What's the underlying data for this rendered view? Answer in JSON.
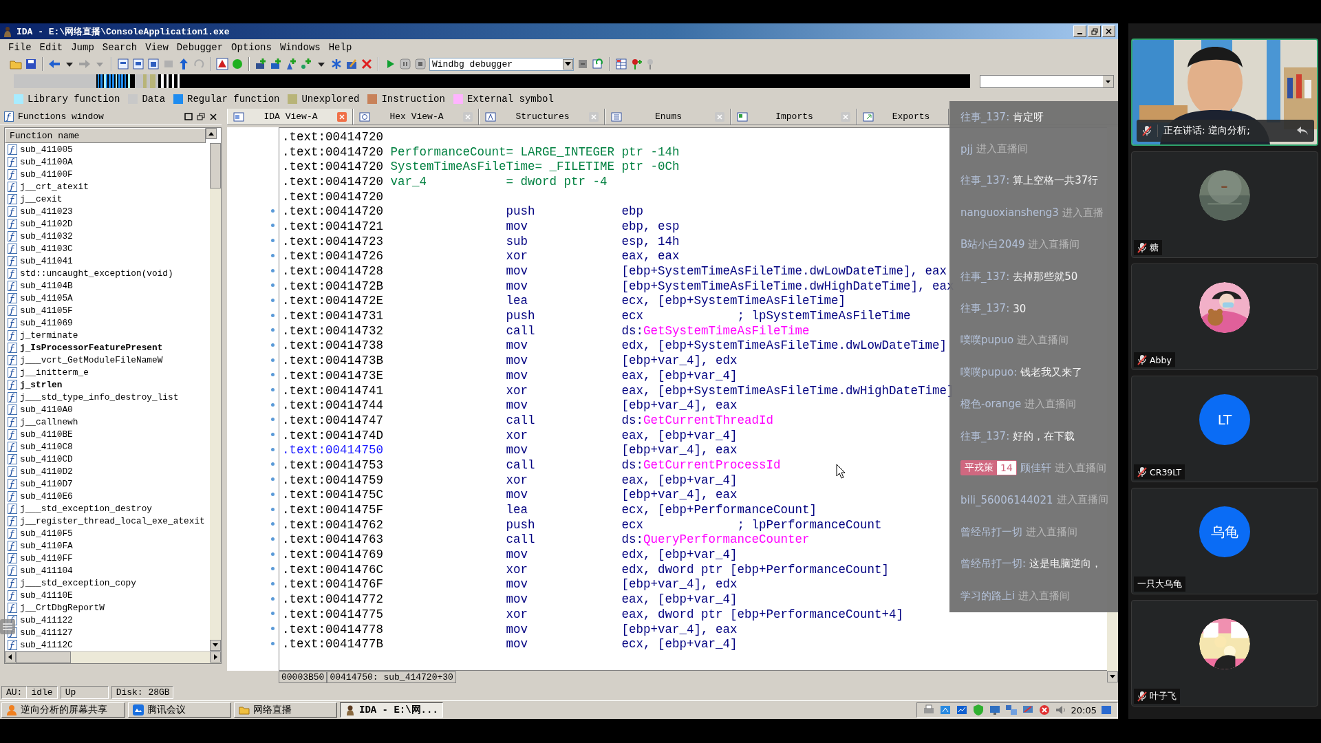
{
  "window": {
    "title": "IDA - E:\\网络直播\\ConsoleApplication1.exe"
  },
  "menu": [
    "File",
    "Edit",
    "Jump",
    "Search",
    "View",
    "Debugger",
    "Options",
    "Windows",
    "Help"
  ],
  "toolbar": {
    "debugger": "Windbg debugger"
  },
  "legend": [
    {
      "label": "Library function",
      "color": "#a8ecff"
    },
    {
      "label": "Data",
      "color": "#c8c8c8"
    },
    {
      "label": "Regular function",
      "color": "#1e8cf0"
    },
    {
      "label": "Unexplored",
      "color": "#b8b478"
    },
    {
      "label": "Instruction",
      "color": "#c8825a"
    },
    {
      "label": "External symbol",
      "color": "#ffb4ff"
    }
  ],
  "functions_window": {
    "title": "Functions window",
    "column": "Function name",
    "items": [
      {
        "name": "sub_411005",
        "bold": false
      },
      {
        "name": "sub_41100A",
        "bold": false
      },
      {
        "name": "sub_41100F",
        "bold": false
      },
      {
        "name": "j__crt_atexit",
        "bold": false
      },
      {
        "name": "j__cexit",
        "bold": false
      },
      {
        "name": "sub_411023",
        "bold": false
      },
      {
        "name": "sub_41102D",
        "bold": false
      },
      {
        "name": "sub_411032",
        "bold": false
      },
      {
        "name": "sub_41103C",
        "bold": false
      },
      {
        "name": "sub_411041",
        "bold": false
      },
      {
        "name": "std::uncaught_exception(void)",
        "bold": false
      },
      {
        "name": "sub_41104B",
        "bold": false
      },
      {
        "name": "sub_41105A",
        "bold": false
      },
      {
        "name": "sub_41105F",
        "bold": false
      },
      {
        "name": "sub_411069",
        "bold": false
      },
      {
        "name": "j_terminate",
        "bold": false
      },
      {
        "name": "j_IsProcessorFeaturePresent",
        "bold": true
      },
      {
        "name": "j___vcrt_GetModuleFileNameW",
        "bold": false
      },
      {
        "name": "j__initterm_e",
        "bold": false
      },
      {
        "name": "j_strlen",
        "bold": true
      },
      {
        "name": "j___std_type_info_destroy_list",
        "bold": false
      },
      {
        "name": "sub_4110A0",
        "bold": false
      },
      {
        "name": "j__callnewh",
        "bold": false
      },
      {
        "name": "sub_4110BE",
        "bold": false
      },
      {
        "name": "sub_4110C8",
        "bold": false
      },
      {
        "name": "sub_4110CD",
        "bold": false
      },
      {
        "name": "sub_4110D2",
        "bold": false
      },
      {
        "name": "sub_4110D7",
        "bold": false
      },
      {
        "name": "sub_4110E6",
        "bold": false
      },
      {
        "name": "j___std_exception_destroy",
        "bold": false
      },
      {
        "name": "j__register_thread_local_exe_atexit",
        "bold": false
      },
      {
        "name": "sub_4110F5",
        "bold": false
      },
      {
        "name": "sub_4110FA",
        "bold": false
      },
      {
        "name": "sub_4110FF",
        "bold": false
      },
      {
        "name": "sub_411104",
        "bold": false
      },
      {
        "name": "j___std_exception_copy",
        "bold": false
      },
      {
        "name": "sub_41110E",
        "bold": false
      },
      {
        "name": "j__CrtDbgReportW",
        "bold": false
      },
      {
        "name": "sub_411122",
        "bold": false
      },
      {
        "name": "sub_411127",
        "bold": false
      },
      {
        "name": "sub_41112C",
        "bold": false
      }
    ]
  },
  "tabs": [
    {
      "label": "IDA View-A",
      "selected": true
    },
    {
      "label": "Hex View-A",
      "selected": false
    },
    {
      "label": "Structures",
      "selected": false
    },
    {
      "label": "Enums",
      "selected": false
    },
    {
      "label": "Imports",
      "selected": false
    },
    {
      "label": "Exports",
      "selected": false
    }
  ],
  "listing": {
    "location": "00003B50",
    "position": "00414750: sub_414720+30",
    "lines": [
      {
        "kind": "blank",
        "address": ".text:00414720",
        "current": false
      },
      {
        "kind": "stackvar",
        "address": ".text:00414720",
        "name": "PerformanceCount",
        "definition": "= LARGE_INTEGER ptr -14h",
        "current": false
      },
      {
        "kind": "stackvar",
        "address": ".text:00414720",
        "name": "SystemTimeAsFileTime",
        "definition": "= _FILETIME ptr -0Ch",
        "current": false
      },
      {
        "kind": "stackvar",
        "address": ".text:00414720",
        "name": "var_4",
        "definition": "= dword ptr -4",
        "current": false
      },
      {
        "kind": "blank",
        "address": ".text:00414720",
        "current": false
      },
      {
        "kind": "instruction",
        "address": ".text:00414720",
        "mnemonic": "push",
        "operands": "ebp",
        "current": false
      },
      {
        "kind": "instruction",
        "address": ".text:00414721",
        "mnemonic": "mov",
        "operands": "ebp, esp",
        "current": false
      },
      {
        "kind": "instruction",
        "address": ".text:00414723",
        "mnemonic": "sub",
        "operands": "esp, 14h",
        "current": false
      },
      {
        "kind": "instruction",
        "address": ".text:00414726",
        "mnemonic": "xor",
        "operands": "eax, eax",
        "current": false
      },
      {
        "kind": "instruction",
        "address": ".text:00414728",
        "mnemonic": "mov",
        "operands": "[ebp+SystemTimeAsFileTime.dwLowDateTime], eax",
        "current": false
      },
      {
        "kind": "instruction",
        "address": ".text:0041472B",
        "mnemonic": "mov",
        "operands": "[ebp+SystemTimeAsFileTime.dwHighDateTime], eax",
        "current": false
      },
      {
        "kind": "instruction",
        "address": ".text:0041472E",
        "mnemonic": "lea",
        "operands": "ecx, [ebp+SystemTimeAsFileTime]",
        "current": false
      },
      {
        "kind": "instruction",
        "address": ".text:00414731",
        "mnemonic": "push",
        "operands": "ecx",
        "comment": "; lpSystemTimeAsFileTime",
        "current": false
      },
      {
        "kind": "instruction",
        "address": ".text:00414732",
        "mnemonic": "call",
        "operands": "ds:",
        "symbol": "GetSystemTimeAsFileTime",
        "current": false
      },
      {
        "kind": "instruction",
        "address": ".text:00414738",
        "mnemonic": "mov",
        "operands": "edx, [ebp+SystemTimeAsFileTime.dwLowDateTime]",
        "current": false
      },
      {
        "kind": "instruction",
        "address": ".text:0041473B",
        "mnemonic": "mov",
        "operands": "[ebp+var_4], edx",
        "current": false
      },
      {
        "kind": "instruction",
        "address": ".text:0041473E",
        "mnemonic": "mov",
        "operands": "eax, [ebp+var_4]",
        "current": false
      },
      {
        "kind": "instruction",
        "address": ".text:00414741",
        "mnemonic": "xor",
        "operands": "eax, [ebp+SystemTimeAsFileTime.dwHighDateTime]",
        "current": false
      },
      {
        "kind": "instruction",
        "address": ".text:00414744",
        "mnemonic": "mov",
        "operands": "[ebp+var_4], eax",
        "current": false
      },
      {
        "kind": "instruction",
        "address": ".text:00414747",
        "mnemonic": "call",
        "operands": "ds:",
        "symbol": "GetCurrentThreadId",
        "current": false
      },
      {
        "kind": "instruction",
        "address": ".text:0041474D",
        "mnemonic": "xor",
        "operands": "eax, [ebp+var_4]",
        "current": false
      },
      {
        "kind": "instruction",
        "address": ".text:00414750",
        "mnemonic": "mov",
        "operands": "[ebp+var_4], eax",
        "current": true
      },
      {
        "kind": "instruction",
        "address": ".text:00414753",
        "mnemonic": "call",
        "operands": "ds:",
        "symbol": "GetCurrentProcessId",
        "current": false
      },
      {
        "kind": "instruction",
        "address": ".text:00414759",
        "mnemonic": "xor",
        "operands": "eax, [ebp+var_4]",
        "current": false
      },
      {
        "kind": "instruction",
        "address": ".text:0041475C",
        "mnemonic": "mov",
        "operands": "[ebp+var_4], eax",
        "current": false
      },
      {
        "kind": "instruction",
        "address": ".text:0041475F",
        "mnemonic": "lea",
        "operands": "ecx, [ebp+PerformanceCount]",
        "current": false
      },
      {
        "kind": "instruction",
        "address": ".text:00414762",
        "mnemonic": "push",
        "operands": "ecx",
        "comment": "; lpPerformanceCount",
        "current": false
      },
      {
        "kind": "instruction",
        "address": ".text:00414763",
        "mnemonic": "call",
        "operands": "ds:",
        "symbol": "QueryPerformanceCounter",
        "current": false
      },
      {
        "kind": "instruction",
        "address": ".text:00414769",
        "mnemonic": "mov",
        "operands": "edx, [ebp+var_4]",
        "current": false
      },
      {
        "kind": "instruction",
        "address": ".text:0041476C",
        "mnemonic": "xor",
        "operands": "edx, dword ptr [ebp+PerformanceCount]",
        "current": false
      },
      {
        "kind": "instruction",
        "address": ".text:0041476F",
        "mnemonic": "mov",
        "operands": "[ebp+var_4], edx",
        "current": false
      },
      {
        "kind": "instruction",
        "address": ".text:00414772",
        "mnemonic": "mov",
        "operands": "eax, [ebp+var_4]",
        "current": false
      },
      {
        "kind": "instruction",
        "address": ".text:00414775",
        "mnemonic": "xor",
        "operands": "eax, dword ptr [ebp+PerformanceCount+4]",
        "current": false
      },
      {
        "kind": "instruction",
        "address": ".text:00414778",
        "mnemonic": "mov",
        "operands": "[ebp+var_4], eax",
        "current": false
      },
      {
        "kind": "instruction",
        "address": ".text:0041477B",
        "mnemonic": "mov",
        "operands": "ecx, [ebp+var_4]",
        "current": false
      }
    ]
  },
  "chat": [
    {
      "kind": "message",
      "user": "往事_137:",
      "text": "肯定呀"
    },
    {
      "kind": "join",
      "user": "pjj",
      "text": "进入直播间"
    },
    {
      "kind": "message",
      "user": "往事_137:",
      "text": "算上空格一共37行"
    },
    {
      "kind": "join",
      "user": "nanguoxiansheng3",
      "text": "进入直播"
    },
    {
      "kind": "join",
      "user": "B站小白2049",
      "text": "进入直播间"
    },
    {
      "kind": "message",
      "user": "往事_137:",
      "text": "去掉那些就50"
    },
    {
      "kind": "message",
      "user": "往事_137:",
      "text": "30"
    },
    {
      "kind": "join",
      "user": "噗噗pupuo",
      "text": "进入直播间"
    },
    {
      "kind": "message",
      "user": "噗噗pupuo:",
      "text": "钱老我又来了"
    },
    {
      "kind": "join",
      "user": "橙色-orange",
      "text": "进入直播间"
    },
    {
      "kind": "message",
      "user": "往事_137:",
      "text": "好的，在下载"
    },
    {
      "kind": "join",
      "badge": {
        "name": "平戎策",
        "level": "14"
      },
      "user": "顾佳轩",
      "text": "进入直播间"
    },
    {
      "kind": "join",
      "user": "bili_56006144021",
      "text": "进入直播间"
    },
    {
      "kind": "join",
      "user": "曾经吊打一切",
      "text": "进入直播间"
    },
    {
      "kind": "message",
      "user": "曾经吊打一切:",
      "text": "这是电脑逆向，"
    },
    {
      "kind": "join",
      "user": "学习的路上i",
      "text": "进入直播间"
    }
  ],
  "status_bar": [
    "AU:",
    "idle",
    "Up",
    "Disk: 28GB"
  ],
  "taskbar": {
    "items": [
      {
        "label": "逆向分析的屏幕共享",
        "selected": false
      },
      {
        "label": "腾讯会议",
        "selected": false
      },
      {
        "label": "网络直播",
        "selected": false
      },
      {
        "label": "IDA - E:\\网...",
        "selected": true
      }
    ],
    "clock": "20:05"
  },
  "meeting": {
    "speaker": "正在讲话: 逆向分析;",
    "participants": [
      {
        "name": "糖",
        "muted": true
      },
      {
        "name": "Abby",
        "muted": true
      },
      {
        "name": "CR39LT",
        "muted": true,
        "avatar": {
          "kind": "initials",
          "text": "LT",
          "color": "#0a6cf5"
        }
      },
      {
        "name": "一只大乌龟",
        "muted": false,
        "avatar": {
          "kind": "initials",
          "text": "乌龟",
          "color": "#0a6cf5"
        }
      },
      {
        "name": "叶子飞",
        "muted": true
      }
    ]
  }
}
